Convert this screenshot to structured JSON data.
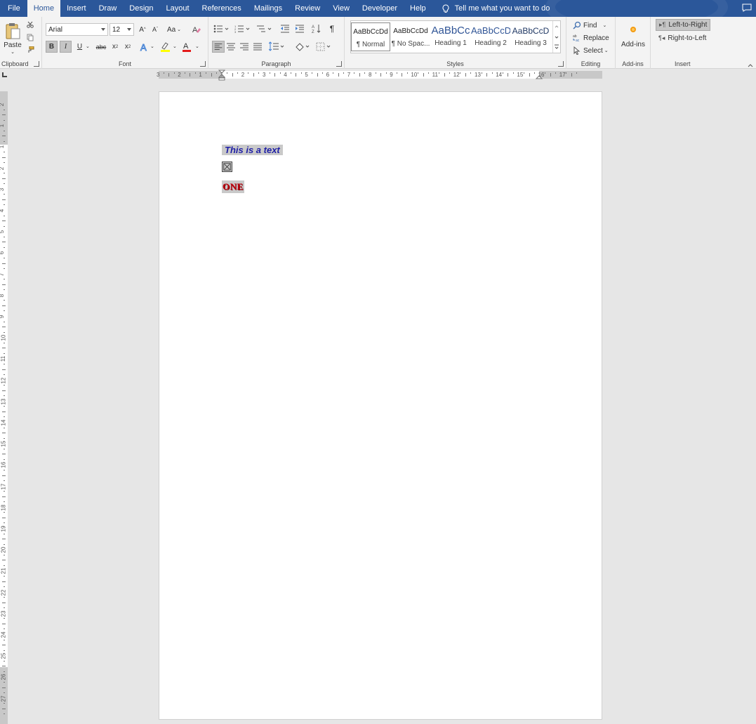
{
  "tabs": [
    "File",
    "Home",
    "Insert",
    "Draw",
    "Design",
    "Layout",
    "References",
    "Mailings",
    "Review",
    "View",
    "Developer",
    "Help"
  ],
  "active_tab": "Home",
  "tell_me": "Tell me what you want to do",
  "clipboard": {
    "paste": "Paste",
    "label": "Clipboard"
  },
  "font": {
    "name": "Arial",
    "size": "12",
    "case_label": "Aa",
    "strike_label": "abc",
    "label": "Font"
  },
  "paragraph": {
    "label": "Paragraph"
  },
  "styles": {
    "label": "Styles",
    "items": [
      {
        "sample": "AaBbCcDd",
        "name": "¶ Normal"
      },
      {
        "sample": "AaBbCcDd",
        "name": "¶ No Spac..."
      },
      {
        "sample": "AaBbCc",
        "name": "Heading 1"
      },
      {
        "sample": "AaBbCcD",
        "name": "Heading 2"
      },
      {
        "sample": "AaBbCcD",
        "name": "Heading 3"
      }
    ]
  },
  "editing": {
    "find": "Find",
    "replace": "Replace",
    "select": "Select",
    "label": "Editing"
  },
  "addins": {
    "button": "Add-ins",
    "label": "Add-ins"
  },
  "insert": {
    "ltr": "Left-to-Right",
    "rtl": "Right-to-Left",
    "label": "Insert"
  },
  "ruler": {
    "h_numbers": [
      "3",
      "2",
      "1",
      "1",
      "2",
      "3",
      "4",
      "5",
      "6",
      "7",
      "8",
      "9",
      "10",
      "11",
      "12",
      "13",
      "14",
      "15",
      "16",
      "17"
    ],
    "v_numbers": [
      "2",
      "1",
      "1",
      "2",
      "3",
      "4",
      "5",
      "6",
      "7",
      "8",
      "9",
      "10",
      "11",
      "12",
      "13",
      "14",
      "15",
      "16",
      "17",
      "18",
      "19",
      "20",
      "21",
      "22",
      "23",
      "24",
      "25",
      "26",
      "27"
    ]
  },
  "document": {
    "line1": "This is a text",
    "line3": "ONE"
  },
  "colors": {
    "accent": "#2b579a",
    "text_blue": "#1f1fa6",
    "text_red": "#c0000c",
    "highlight_grey": "#c9c9c9"
  }
}
